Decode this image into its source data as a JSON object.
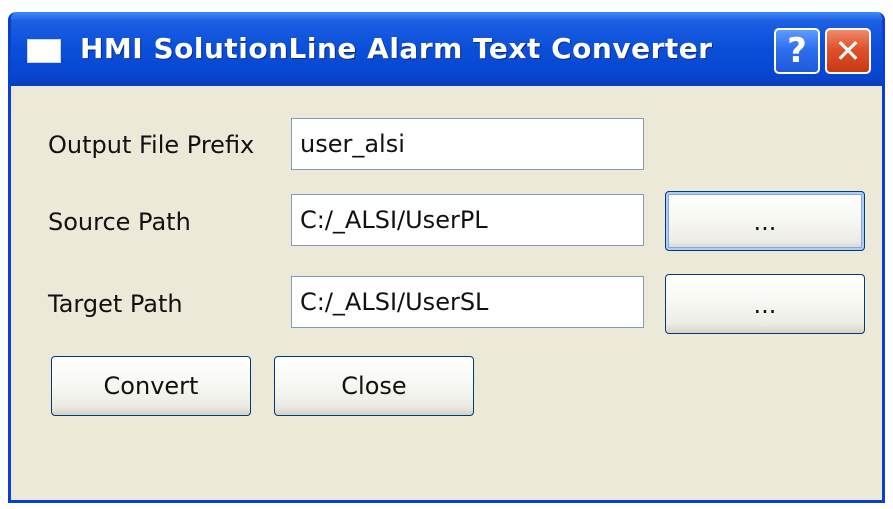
{
  "window": {
    "title": "HMI SolutionLine Alarm Text Converter",
    "help_icon_glyph": "?",
    "close_icon_glyph": "✕"
  },
  "form": {
    "prefix_label": "Output File Prefix",
    "prefix_value": "user_alsi",
    "source_label": "Source Path",
    "source_value": "C:/_ALSI/UserPL",
    "source_browse_label": "...",
    "target_label": "Target Path",
    "target_value": "C:/_ALSI/UserSL",
    "target_browse_label": "..."
  },
  "actions": {
    "convert_label": "Convert",
    "close_label": "Close"
  },
  "colors": {
    "titlebar": "#0a4fd9",
    "window_bg": "#ece9d8",
    "close_button": "#e1502a",
    "help_button": "#2e6ff0"
  }
}
